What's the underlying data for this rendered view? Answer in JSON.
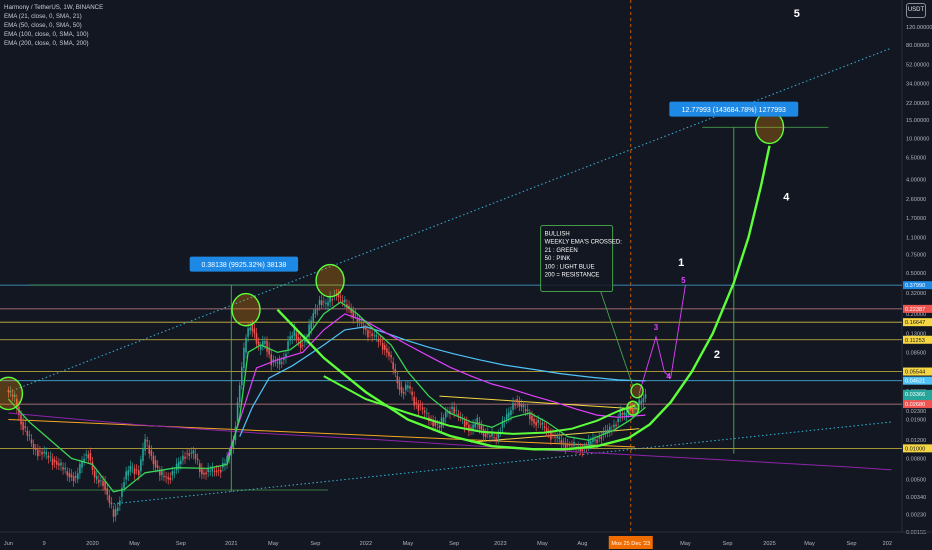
{
  "header": {
    "title": "Harmony / TetherUS, 1W, BINANCE",
    "indicators": [
      "EMA (21, close, 0, SMA, 21)",
      "EMA (50, close, 0, SMA, 50)",
      "EMA (100, close, 0, SMA, 100)",
      "EMA (200, close, 0, SMA, 200)"
    ],
    "scale_button": "USDT"
  },
  "colors": {
    "background": "#131722",
    "up": "#26a69a",
    "down": "#ef5350",
    "ema21": "#39d353",
    "ema50": "#e040fb",
    "ema100": "#4fc3f7",
    "ema200": "#8e24aa",
    "projection": "#5dff3a",
    "trendline": "#38b6d8",
    "box_green": "#4caf50",
    "label_blue": "#1e88e5"
  },
  "chart_data": {
    "type": "candlestick",
    "scale": "log",
    "ylim": [
      0.00155,
      200
    ],
    "y_ticks": [
      "120.00000",
      "80.00000",
      "52.00000",
      "34.00000",
      "22.00000",
      "15.00000",
      "10.00000",
      "6.50000",
      "4.00000",
      "2.60000",
      "1.70000",
      "1.10000",
      "0.75000",
      "0.50000",
      "0.32000",
      "0.20000",
      "0.13000",
      "0.08500",
      "0.05500",
      "0.03600",
      "0.02300",
      "0.01900",
      "0.01200",
      "0.00800",
      "0.00500",
      "0.00340",
      "0.00230",
      "0.00155"
    ],
    "y_tick_values": [
      120,
      80,
      52,
      34,
      22,
      15,
      10,
      6.5,
      4,
      2.6,
      1.7,
      1.1,
      0.75,
      0.5,
      0.32,
      0.2,
      0.13,
      0.085,
      0.055,
      0.036,
      0.023,
      0.019,
      0.012,
      0.008,
      0.005,
      0.0034,
      0.0023,
      0.00155
    ],
    "x_ticks": [
      "Jun",
      "9",
      "2020",
      "May",
      "Sep",
      "2021",
      "May",
      "Sep",
      "2022",
      "May",
      "Sep",
      "2023",
      "May",
      "Aug",
      "Mos 25 Dec '23",
      "May",
      "Sep",
      "2025",
      "May",
      "Sep",
      "202"
    ],
    "x_tick_weeks": [
      0,
      17,
      40,
      60,
      82,
      106,
      126,
      146,
      170,
      190,
      212,
      234,
      254,
      273,
      296,
      322,
      342,
      362,
      381,
      401,
      418
    ],
    "cursor_week": 296,
    "price_labels": [
      {
        "text": "0.37990",
        "value": 0.3799,
        "color": "#1e88e5"
      },
      {
        "text": "0.22387",
        "value": 0.2239,
        "color": "#ef5350"
      },
      {
        "text": "0.16647",
        "value": 0.1665,
        "color": "#f6d743"
      },
      {
        "text": "0.11253",
        "value": 0.1125,
        "color": "#f6d743"
      },
      {
        "text": "0.05544",
        "value": 0.0554,
        "color": "#f6d743"
      },
      {
        "text": "0.04521",
        "value": 0.0452,
        "color": "#4fc3f7"
      },
      {
        "text": "0.03366",
        "value": 0.0337,
        "color": "#26a69a"
      },
      {
        "text": "0.02680",
        "value": 0.0268,
        "color": "#ef5350"
      },
      {
        "text": "0.01000",
        "value": 0.01,
        "color": "#f6d743"
      }
    ],
    "price_label_sub": "4d 7h",
    "horizontal_levels": [
      {
        "value": 0.38,
        "color": "#4fc3f7"
      },
      {
        "value": 0.2239,
        "color": "#ef9a9a"
      },
      {
        "value": 0.1665,
        "color": "#f6d743"
      },
      {
        "value": 0.1125,
        "color": "#f6d743"
      },
      {
        "value": 0.0554,
        "color": "#f6d743"
      },
      {
        "value": 0.0452,
        "color": "#4fc3f7"
      },
      {
        "value": 0.0268,
        "color": "#ef9a9a"
      },
      {
        "value": 0.01,
        "color": "#f6d743"
      },
      {
        "value": 0.00395,
        "color": "#4caf50"
      },
      {
        "value": 0.38138,
        "color": "#4caf50"
      },
      {
        "value": 12.8,
        "color": "#4caf50"
      }
    ],
    "candle_keyframes": [
      [
        0,
        0.035
      ],
      [
        3,
        0.03
      ],
      [
        6,
        0.018
      ],
      [
        12,
        0.01
      ],
      [
        18,
        0.0085
      ],
      [
        22,
        0.0075
      ],
      [
        27,
        0.006
      ],
      [
        32,
        0.005
      ],
      [
        36,
        0.0085
      ],
      [
        38,
        0.009
      ],
      [
        41,
        0.005
      ],
      [
        45,
        0.0048
      ],
      [
        48,
        0.003
      ],
      [
        50,
        0.0022
      ],
      [
        52,
        0.0028
      ],
      [
        55,
        0.005
      ],
      [
        58,
        0.0065
      ],
      [
        62,
        0.006
      ],
      [
        65,
        0.012
      ],
      [
        68,
        0.0085
      ],
      [
        72,
        0.0055
      ],
      [
        76,
        0.0052
      ],
      [
        80,
        0.0065
      ],
      [
        84,
        0.009
      ],
      [
        88,
        0.0088
      ],
      [
        92,
        0.0058
      ],
      [
        96,
        0.006
      ],
      [
        100,
        0.0062
      ],
      [
        103,
        0.0072
      ],
      [
        105,
        0.0085
      ],
      [
        107,
        0.012
      ],
      [
        109,
        0.028
      ],
      [
        111,
        0.06
      ],
      [
        113,
        0.12
      ],
      [
        115,
        0.16
      ],
      [
        117,
        0.13
      ],
      [
        119,
        0.09
      ],
      [
        122,
        0.11
      ],
      [
        125,
        0.07
      ],
      [
        128,
        0.065
      ],
      [
        131,
        0.075
      ],
      [
        133,
        0.11
      ],
      [
        136,
        0.13
      ],
      [
        139,
        0.1
      ],
      [
        142,
        0.12
      ],
      [
        145,
        0.2
      ],
      [
        148,
        0.27
      ],
      [
        151,
        0.24
      ],
      [
        154,
        0.3
      ],
      [
        156,
        0.32
      ],
      [
        158,
        0.27
      ],
      [
        162,
        0.23
      ],
      [
        166,
        0.17
      ],
      [
        170,
        0.14
      ],
      [
        174,
        0.12
      ],
      [
        178,
        0.1
      ],
      [
        181,
        0.08
      ],
      [
        184,
        0.05
      ],
      [
        187,
        0.035
      ],
      [
        190,
        0.04
      ],
      [
        193,
        0.028
      ],
      [
        196,
        0.025
      ],
      [
        199,
        0.02
      ],
      [
        202,
        0.018
      ],
      [
        205,
        0.016
      ],
      [
        208,
        0.022
      ],
      [
        211,
        0.025
      ],
      [
        214,
        0.02
      ],
      [
        217,
        0.018
      ],
      [
        220,
        0.015
      ],
      [
        223,
        0.018
      ],
      [
        226,
        0.014
      ],
      [
        229,
        0.013
      ],
      [
        232,
        0.0125
      ],
      [
        235,
        0.018
      ],
      [
        238,
        0.021
      ],
      [
        241,
        0.03
      ],
      [
        244,
        0.025
      ],
      [
        247,
        0.022
      ],
      [
        250,
        0.018
      ],
      [
        253,
        0.017
      ],
      [
        256,
        0.015
      ],
      [
        259,
        0.013
      ],
      [
        262,
        0.012
      ],
      [
        265,
        0.011
      ],
      [
        268,
        0.0105
      ],
      [
        271,
        0.01
      ],
      [
        274,
        0.0102
      ],
      [
        277,
        0.0115
      ],
      [
        280,
        0.0125
      ],
      [
        283,
        0.014
      ],
      [
        286,
        0.015
      ],
      [
        289,
        0.018
      ],
      [
        291,
        0.022
      ],
      [
        293,
        0.02
      ],
      [
        295,
        0.025
      ],
      [
        297,
        0.024
      ],
      [
        299,
        0.026
      ],
      [
        301,
        0.028
      ],
      [
        303,
        0.033
      ]
    ],
    "ema21": [
      [
        0,
        0.03
      ],
      [
        10,
        0.018
      ],
      [
        20,
        0.012
      ],
      [
        30,
        0.008
      ],
      [
        40,
        0.007
      ],
      [
        50,
        0.0038
      ],
      [
        55,
        0.004
      ],
      [
        65,
        0.0058
      ],
      [
        80,
        0.0065
      ],
      [
        95,
        0.0064
      ],
      [
        104,
        0.007
      ],
      [
        110,
        0.02
      ],
      [
        114,
        0.085
      ],
      [
        120,
        0.1
      ],
      [
        128,
        0.085
      ],
      [
        134,
        0.09
      ],
      [
        142,
        0.12
      ],
      [
        150,
        0.2
      ],
      [
        158,
        0.26
      ],
      [
        166,
        0.2
      ],
      [
        174,
        0.14
      ],
      [
        182,
        0.1
      ],
      [
        190,
        0.055
      ],
      [
        200,
        0.032
      ],
      [
        210,
        0.022
      ],
      [
        220,
        0.018
      ],
      [
        230,
        0.016
      ],
      [
        240,
        0.02
      ],
      [
        248,
        0.022
      ],
      [
        256,
        0.018
      ],
      [
        266,
        0.013
      ],
      [
        276,
        0.012
      ],
      [
        288,
        0.015
      ],
      [
        296,
        0.019
      ],
      [
        303,
        0.025
      ]
    ],
    "ema50": [
      [
        104,
        0.008
      ],
      [
        112,
        0.025
      ],
      [
        118,
        0.06
      ],
      [
        128,
        0.072
      ],
      [
        140,
        0.085
      ],
      [
        150,
        0.14
      ],
      [
        160,
        0.2
      ],
      [
        170,
        0.17
      ],
      [
        180,
        0.13
      ],
      [
        190,
        0.1
      ],
      [
        200,
        0.078
      ],
      [
        210,
        0.061
      ],
      [
        220,
        0.05
      ],
      [
        230,
        0.042
      ],
      [
        240,
        0.037
      ],
      [
        250,
        0.032
      ],
      [
        260,
        0.028
      ],
      [
        270,
        0.024
      ],
      [
        280,
        0.021
      ],
      [
        290,
        0.02
      ],
      [
        303,
        0.021
      ]
    ],
    "ema100": [
      [
        110,
        0.013
      ],
      [
        116,
        0.025
      ],
      [
        124,
        0.048
      ],
      [
        135,
        0.063
      ],
      [
        150,
        0.1
      ],
      [
        160,
        0.14
      ],
      [
        170,
        0.15
      ],
      [
        180,
        0.13
      ],
      [
        190,
        0.11
      ],
      [
        200,
        0.095
      ],
      [
        212,
        0.082
      ],
      [
        224,
        0.072
      ],
      [
        236,
        0.064
      ],
      [
        250,
        0.058
      ],
      [
        262,
        0.053
      ],
      [
        276,
        0.049
      ],
      [
        290,
        0.046
      ],
      [
        303,
        0.045
      ]
    ],
    "ema200": [
      [
        0,
        0.022
      ],
      [
        60,
        0.017
      ],
      [
        120,
        0.014
      ],
      [
        180,
        0.012
      ],
      [
        240,
        0.01
      ],
      [
        303,
        0.0085
      ],
      [
        400,
        0.0066
      ],
      [
        420,
        0.0062
      ]
    ],
    "projection_curve": [
      [
        128,
        0.22
      ],
      [
        150,
        0.075
      ],
      [
        170,
        0.035
      ],
      [
        190,
        0.019
      ],
      [
        210,
        0.0132
      ],
      [
        230,
        0.0105
      ],
      [
        250,
        0.0098
      ],
      [
        265,
        0.0098
      ],
      [
        280,
        0.0105
      ],
      [
        295,
        0.0126
      ],
      [
        305,
        0.017
      ],
      [
        315,
        0.028
      ],
      [
        325,
        0.055
      ],
      [
        335,
        0.13
      ],
      [
        345,
        0.4
      ],
      [
        352,
        1.1
      ],
      [
        358,
        3.5
      ],
      [
        362,
        8.5
      ]
    ],
    "mini_curve": [
      [
        150,
        0.05
      ],
      [
        170,
        0.03
      ],
      [
        190,
        0.022
      ],
      [
        210,
        0.0165
      ],
      [
        225,
        0.0145
      ],
      [
        240,
        0.0138
      ],
      [
        255,
        0.0142
      ],
      [
        268,
        0.0155
      ],
      [
        280,
        0.0185
      ],
      [
        290,
        0.023
      ],
      [
        298,
        0.026
      ]
    ],
    "trend_lines": [
      {
        "name": "upper-channel",
        "from": [
          0,
          0.035
        ],
        "to": [
          420,
          75
        ],
        "color": "#38b6d8",
        "dotted": true
      },
      {
        "name": "lower-channel",
        "from": [
          50,
          0.0029
        ],
        "to": [
          420,
          0.018
        ],
        "color": "#38b6d8",
        "dotted": true
      },
      {
        "name": "ema-descending-orange",
        "from": [
          0,
          0.019
        ],
        "to": [
          298,
          0.0103
        ],
        "color": "#f6a623",
        "dotted": false
      },
      {
        "name": "falling-wedge-top",
        "from": [
          205,
          0.032
        ],
        "to": [
          300,
          0.024
        ],
        "color": "#f6d743",
        "dotted": false
      },
      {
        "name": "falling-wedge-bottom",
        "from": [
          220,
          0.0115
        ],
        "to": [
          300,
          0.0155
        ],
        "color": "#f6d743",
        "dotted": false
      }
    ],
    "circles": [
      {
        "week": 0,
        "value": 0.034
      },
      {
        "week": 113,
        "value": 0.22
      },
      {
        "week": 153,
        "value": 0.42
      },
      {
        "week": 297,
        "value": 0.0245
      },
      {
        "week": 299,
        "value": 0.036
      },
      {
        "week": 362,
        "value": 12.8
      }
    ],
    "wave_labels": [
      {
        "text": "1",
        "week": 320,
        "value": 0.58,
        "color": "#ffffff"
      },
      {
        "text": "2",
        "week": 337,
        "value": 0.075,
        "color": "#ffffff"
      },
      {
        "text": "3",
        "week": 308,
        "value": 0.14,
        "color": "#e040fb"
      },
      {
        "text": "4",
        "week": 314,
        "value": 0.047,
        "color": "#e040fb"
      },
      {
        "text": "5",
        "week": 321,
        "value": 0.4,
        "color": "#e040fb"
      },
      {
        "text": "4",
        "week": 370,
        "value": 2.5,
        "color": "#ffffff"
      },
      {
        "text": "5",
        "week": 375,
        "value": 150,
        "color": "#ffffff"
      }
    ],
    "wave_path": [
      [
        300,
        0.034
      ],
      [
        308,
        0.12
      ],
      [
        312,
        0.055
      ],
      [
        315,
        0.048
      ],
      [
        322,
        0.38
      ]
    ],
    "measure_labels": [
      {
        "text": "0.38138 (9925.32%) 38138",
        "week": 112,
        "value": 0.6,
        "from": [
          106,
          0.0038
        ],
        "to": [
          106,
          0.38
        ]
      },
      {
        "text": "12.77993 (143684.78%) 1277993",
        "week": 345,
        "value": 19,
        "from": [
          345,
          0.0089
        ],
        "to": [
          345,
          12.8
        ]
      }
    ],
    "annotation": {
      "lines": [
        "BULLISH",
        "WEEKLY EMA'S CROSSED:",
        "21 : GREEN",
        "50 : PINK",
        "100 : LIGHT BLUE",
        "200 = RESISTANCE"
      ],
      "week": 256,
      "value": 1.2,
      "arrow_to": [
        297,
        0.04
      ]
    }
  }
}
